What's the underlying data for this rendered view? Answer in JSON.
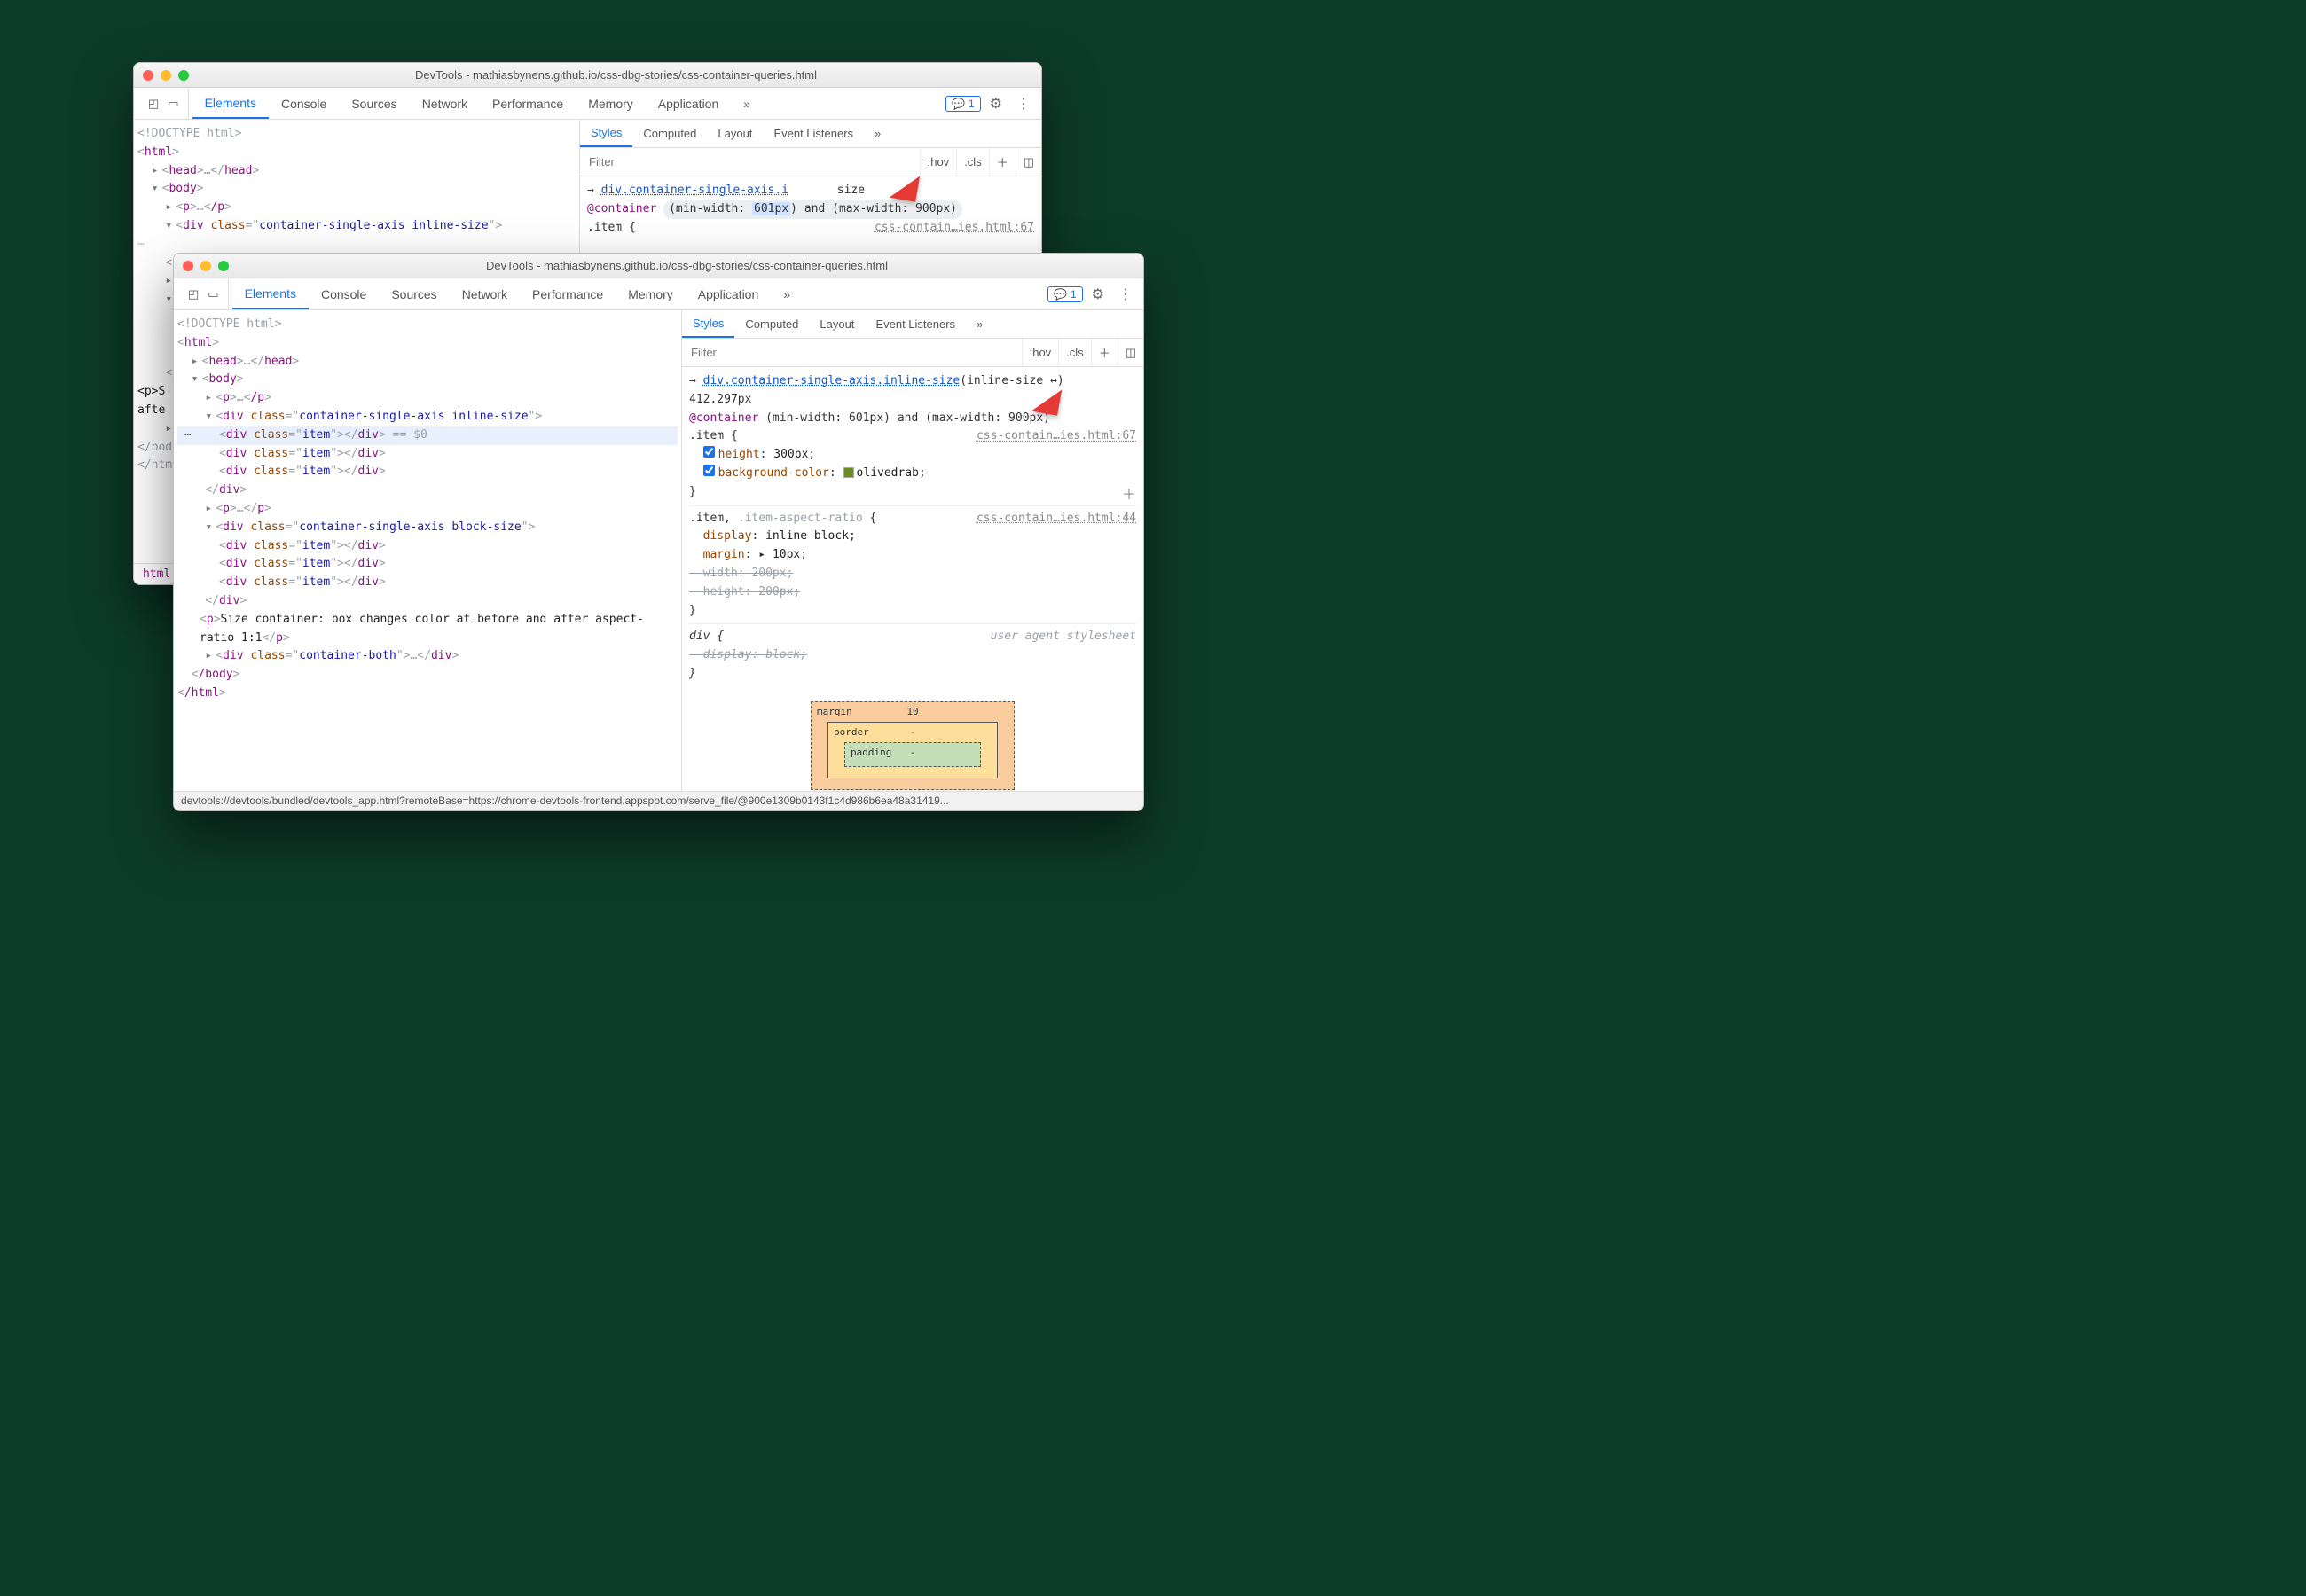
{
  "back_window": {
    "title": "DevTools - mathiasbynens.github.io/css-dbg-stories/css-container-queries.html",
    "tabs": [
      "Elements",
      "Console",
      "Sources",
      "Network",
      "Performance",
      "Memory",
      "Application"
    ],
    "active_tab": "Elements",
    "msg_count": "1",
    "subtabs": [
      "Styles",
      "Computed",
      "Layout",
      "Event Listeners"
    ],
    "active_subtab": "Styles",
    "filter_placeholder": "Filter",
    "hov": ":hov",
    "cls": ".cls",
    "styles": {
      "selector_link": "div.container-single-axis.i",
      "selector_suffix": "size",
      "container_prefix": "@container",
      "cq_left": "(min-width: ",
      "cq_hl": "601px",
      "cq_mid": ") and (max-width: 900px)",
      "rule_selector": ".item {",
      "src": "css-contain…ies.html:67"
    },
    "dom": {
      "doctype": "<!DOCTYPE html>",
      "html_open": "html",
      "head": "head",
      "body": "body",
      "p_open": "p",
      "p_close": "/p",
      "div_class": "container-single-axis inline-size",
      "more": "…",
      "close_di": "</di",
      "p_frag": "<p>S",
      "after_frag": "afte",
      "close_body": "</body",
      "close_html": "</html>"
    },
    "crumbs": "html  boc"
  },
  "front_window": {
    "title": "DevTools - mathiasbynens.github.io/css-dbg-stories/css-container-queries.html",
    "tabs": [
      "Elements",
      "Console",
      "Sources",
      "Network",
      "Performance",
      "Memory",
      "Application"
    ],
    "active_tab": "Elements",
    "msg_count": "1",
    "subtabs": [
      "Styles",
      "Computed",
      "Layout",
      "Event Listeners"
    ],
    "active_subtab": "Styles",
    "filter_placeholder": "Filter",
    "hov": ":hov",
    "cls": ".cls",
    "dom": {
      "doctype": "<!DOCTYPE html>",
      "html": "html",
      "head": "head",
      "body": "body",
      "p": "p",
      "p_close": "/p",
      "div1_class": "container-single-axis inline-size",
      "item": "item",
      "dollar0": "== $0",
      "div2_class": "container-single-axis block-size",
      "paragraph": "Size container: box changes color at before and after aspect-ratio 1:1",
      "div3_class": "container-both",
      "body_close": "/body",
      "html_close": "/html"
    },
    "styles": {
      "selector_link": "div.container-single-axis.inline-size",
      "size_label": "(inline-size ↔)",
      "size_value": "412.297px",
      "container_query": "@container (min-width: 601px) and (max-width: 900px)",
      "rule1_selector": ".item {",
      "rule1_src": "css-contain…ies.html:67",
      "rule1_p1_name": "height",
      "rule1_p1_value": "300px",
      "rule1_p2_name": "background-color",
      "rule1_p2_value": "olivedrab",
      "rule1_close": "}",
      "rule2_selector": ".item, .item-aspect-ratio {",
      "rule2_src": "css-contain…ies.html:44",
      "rule2_p1_name": "display",
      "rule2_p1_value": "inline-block",
      "rule2_p2_name": "margin",
      "rule2_p2_value": "10px",
      "rule2_p3_name": "width",
      "rule2_p3_value": "200px",
      "rule2_p4_name": "height",
      "rule2_p4_value": "200px",
      "rule2_close": "}",
      "rule3_selector": "div {",
      "rule3_src": "user agent stylesheet",
      "rule3_p1": "display: block;",
      "rule3_close": "}"
    },
    "boxmodel": {
      "margin_label": "margin",
      "margin_top": "10",
      "border_label": "border",
      "border_top": "-",
      "padding_label": "padding",
      "padding_top": "-"
    },
    "statusbar": "devtools://devtools/bundled/devtools_app.html?remoteBase=https://chrome-devtools-frontend.appspot.com/serve_file/@900e1309b0143f1c4d986b6ea48a31419..."
  }
}
